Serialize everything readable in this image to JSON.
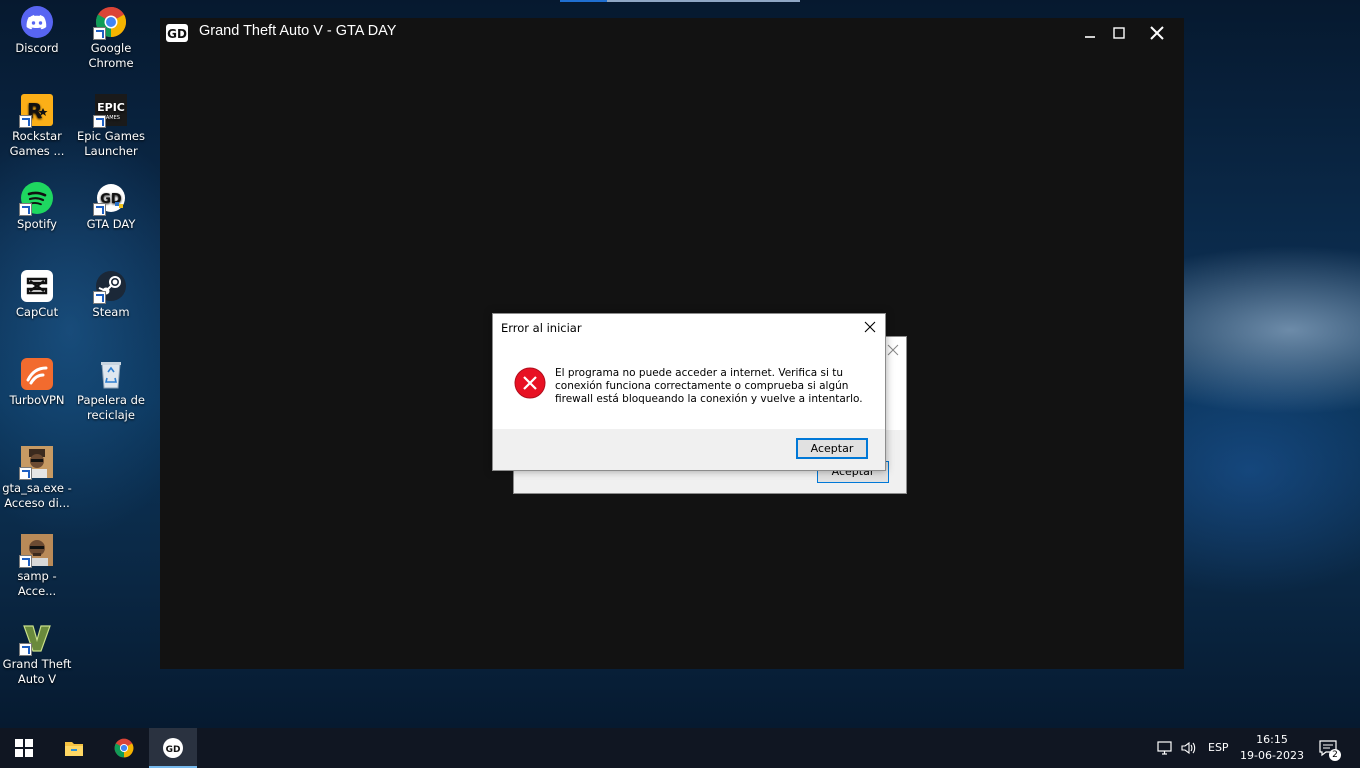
{
  "desktop": {
    "icons": [
      {
        "label_line1": "Discord",
        "label_line2": ""
      },
      {
        "label_line1": "Google",
        "label_line2": "Chrome"
      },
      {
        "label_line1": "Rockstar",
        "label_line2": "Games ..."
      },
      {
        "label_line1": "Epic Games",
        "label_line2": "Launcher"
      },
      {
        "label_line1": "Spotify",
        "label_line2": ""
      },
      {
        "label_line1": "GTA DAY",
        "label_line2": ""
      },
      {
        "label_line1": "CapCut",
        "label_line2": ""
      },
      {
        "label_line1": "Steam",
        "label_line2": ""
      },
      {
        "label_line1": "TurboVPN",
        "label_line2": ""
      },
      {
        "label_line1": "Papelera de",
        "label_line2": "reciclaje"
      },
      {
        "label_line1": "gta_sa.exe -",
        "label_line2": "Acceso di..."
      },
      {
        "label_line1": "samp -",
        "label_line2": "Acce..."
      },
      {
        "label_line1": "Grand Theft",
        "label_line2": "Auto V"
      }
    ],
    "epic_logo_text": "EPIC",
    "epic_logo_sub": "GAMES"
  },
  "game_window": {
    "title": "Grand Theft Auto V - GTA DAY",
    "logo_text": "GD"
  },
  "dialog_back": {
    "ok_label": "Aceptar"
  },
  "dialog_front": {
    "title": "Error al iniciar",
    "message": "El programa no puede acceder a internet. Verifica si tu conexión funciona correctamente o comprueba si algún firewall está bloqueando la conexión y vuelve a intentarlo.",
    "ok_label": "Aceptar"
  },
  "taskbar": {
    "language": "ESP",
    "time": "16:15",
    "date": "19-06-2023",
    "notification_count": "2"
  },
  "colors": {
    "error_red": "#e81123",
    "focus_blue": "#0078d7",
    "taskbar_bg": "#101622"
  }
}
